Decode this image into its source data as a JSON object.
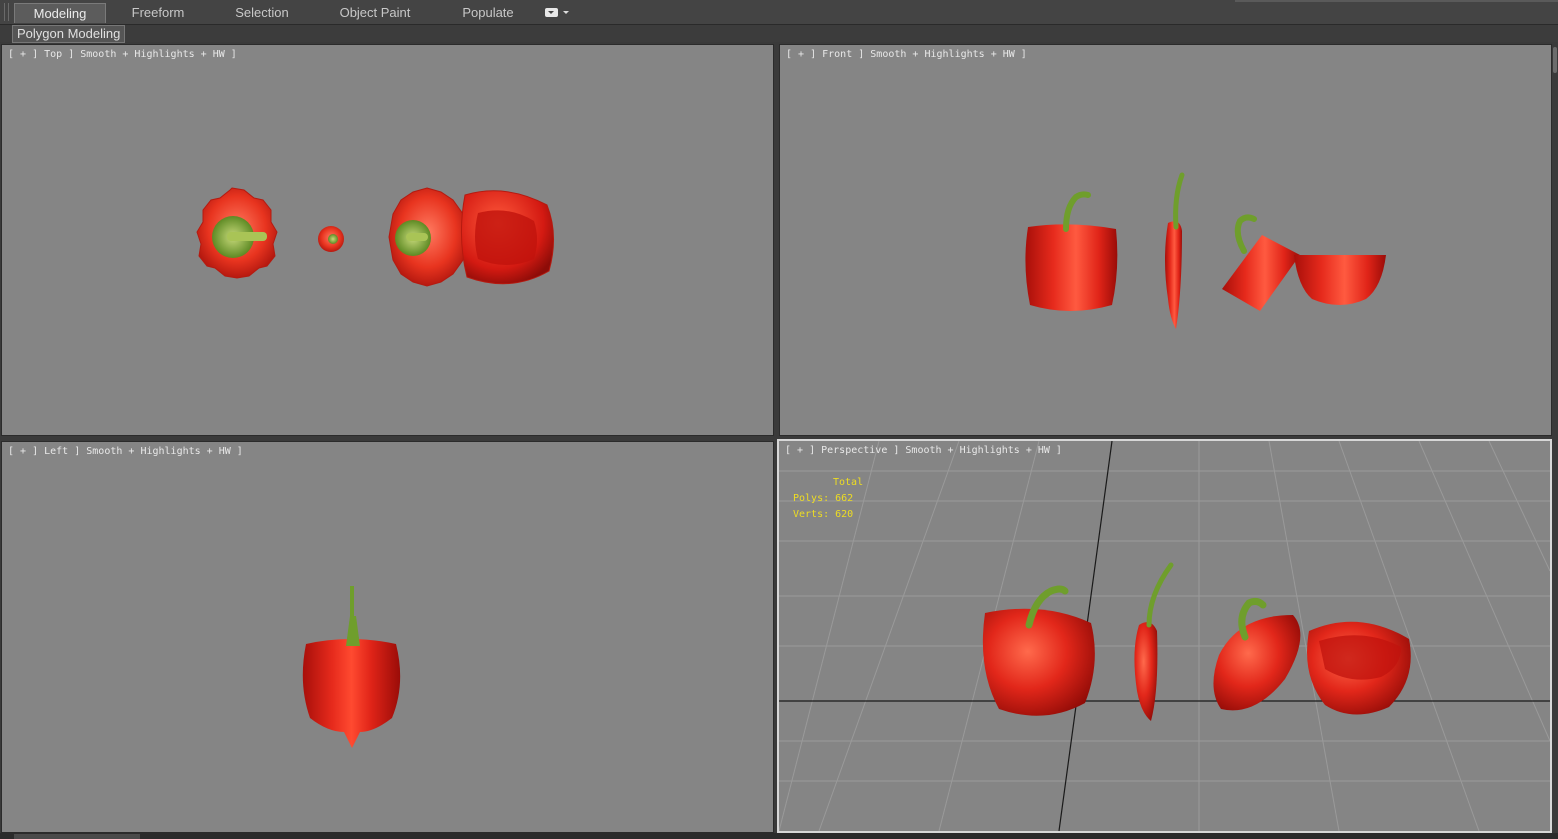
{
  "ribbon": {
    "tabs": [
      {
        "label": "Modeling",
        "active": true
      },
      {
        "label": "Freeform"
      },
      {
        "label": "Selection"
      },
      {
        "label": "Object Paint"
      },
      {
        "label": "Populate"
      }
    ],
    "more_icon": "dropdown-toggle-icon"
  },
  "subbar": {
    "panel_label": "Polygon Modeling"
  },
  "viewports": {
    "top": {
      "label": "[ + ] Top ] Smooth + Highlights + HW ]"
    },
    "front": {
      "label": "[ + ] Front ] Smooth + Highlights + HW ]"
    },
    "left": {
      "label": "[ + ] Left ] Smooth + Highlights + HW ]"
    },
    "perspective": {
      "label": "[ + ] Perspective ] Smooth + Highlights + HW ]"
    }
  },
  "stats": {
    "title": "Total",
    "polys": "Polys: 662",
    "verts": "Verts: 620"
  },
  "colors": {
    "viewport_bg": "#858585",
    "pepper_red": "#e02418",
    "stem_green": "#6f9e2c",
    "stats_yellow": "#eedd22",
    "active_border": "#d7d7d7"
  }
}
